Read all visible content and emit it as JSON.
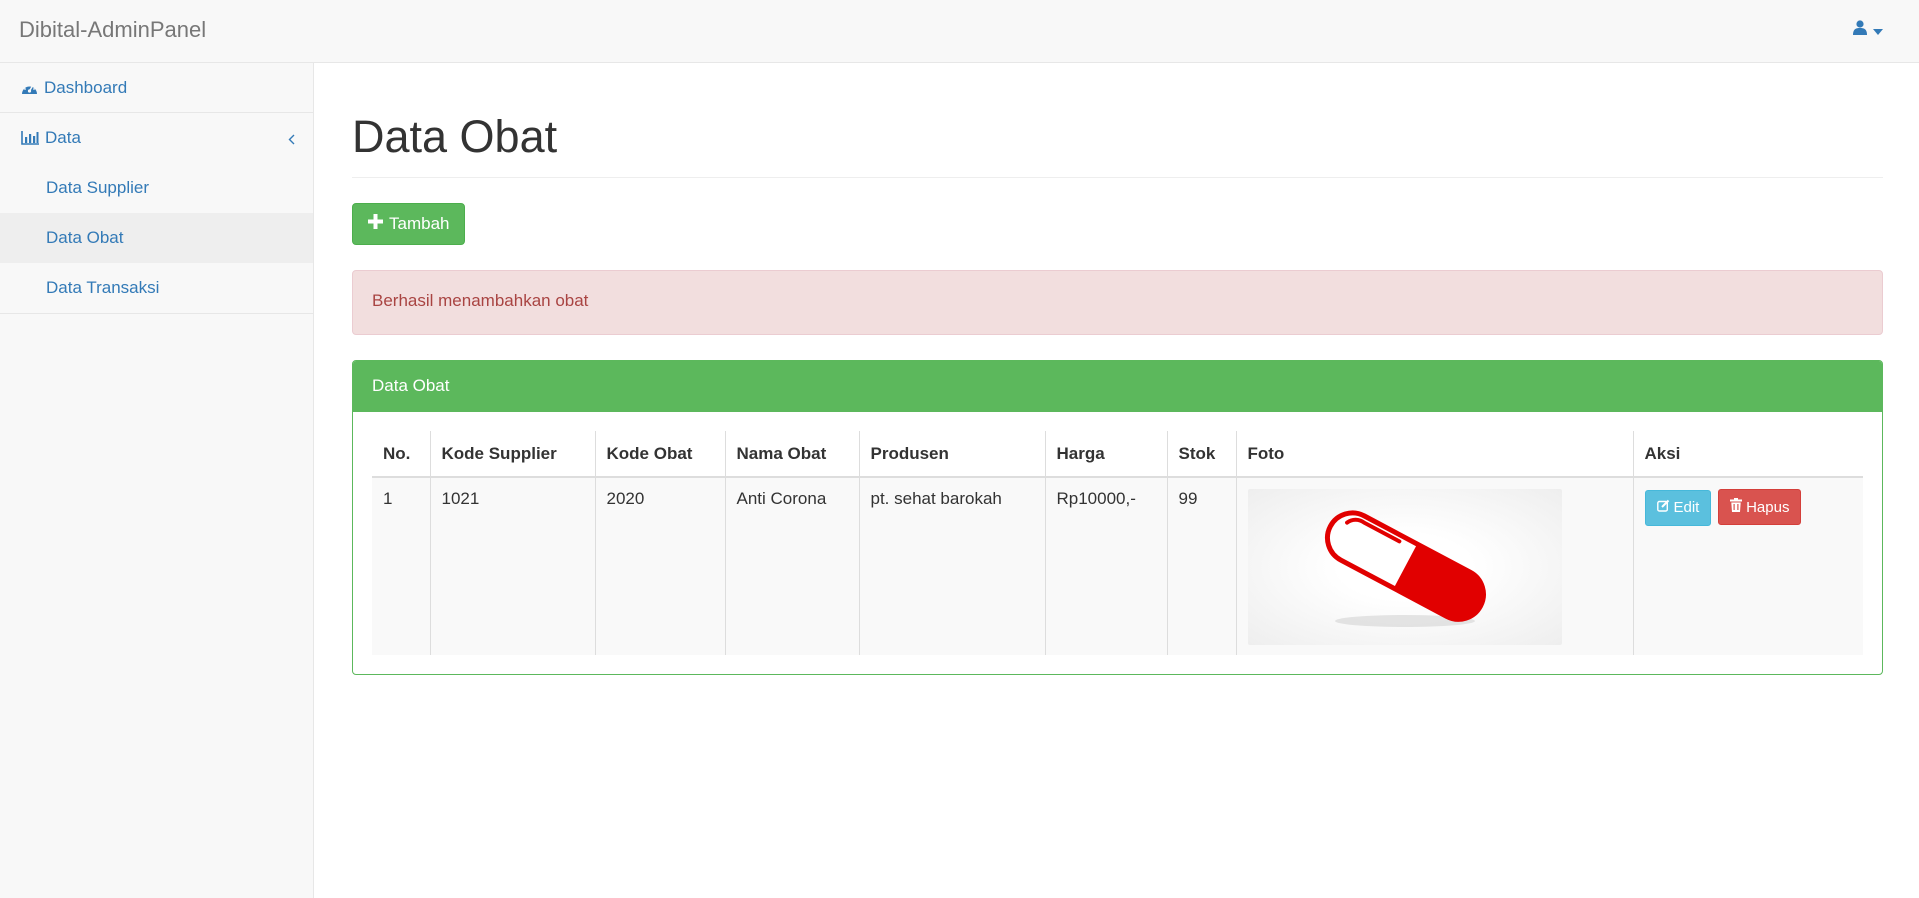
{
  "app": {
    "brand": "Dibital-AdminPanel"
  },
  "user_menu": {
    "icon": "user-icon",
    "caret": "caret-down-icon"
  },
  "sidebar": {
    "items": [
      {
        "label": "Dashboard",
        "icon": "dashboard-icon"
      },
      {
        "label": "Data",
        "icon": "bar-chart-icon"
      }
    ],
    "subitems": [
      {
        "label": "Data Supplier"
      },
      {
        "label": "Data Obat"
      },
      {
        "label": "Data Transaksi"
      }
    ]
  },
  "main": {
    "title": "Data Obat",
    "add_button": "Tambah",
    "alert": "Berhasil menambahkan obat",
    "panel_title": "Data Obat",
    "table": {
      "headers": [
        "No.",
        "Kode Supplier",
        "Kode Obat",
        "Nama Obat",
        "Produsen",
        "Harga",
        "Stok",
        "Foto",
        "Aksi"
      ],
      "rows": [
        {
          "no": "1",
          "kode_supplier": "1021",
          "kode_obat": "2020",
          "nama_obat": "Anti Corona",
          "produsen": "pt. sehat barokah",
          "harga": "Rp10000,-",
          "stok": "99",
          "foto": "red-pill-capsule-image",
          "edit": "Edit",
          "hapus": "Hapus"
        }
      ]
    }
  },
  "colors": {
    "success": "#5cb85c",
    "info": "#5bc0de",
    "danger": "#d9534f",
    "link": "#337ab7",
    "alert_bg": "#f2dede",
    "alert_text": "#a94442"
  }
}
